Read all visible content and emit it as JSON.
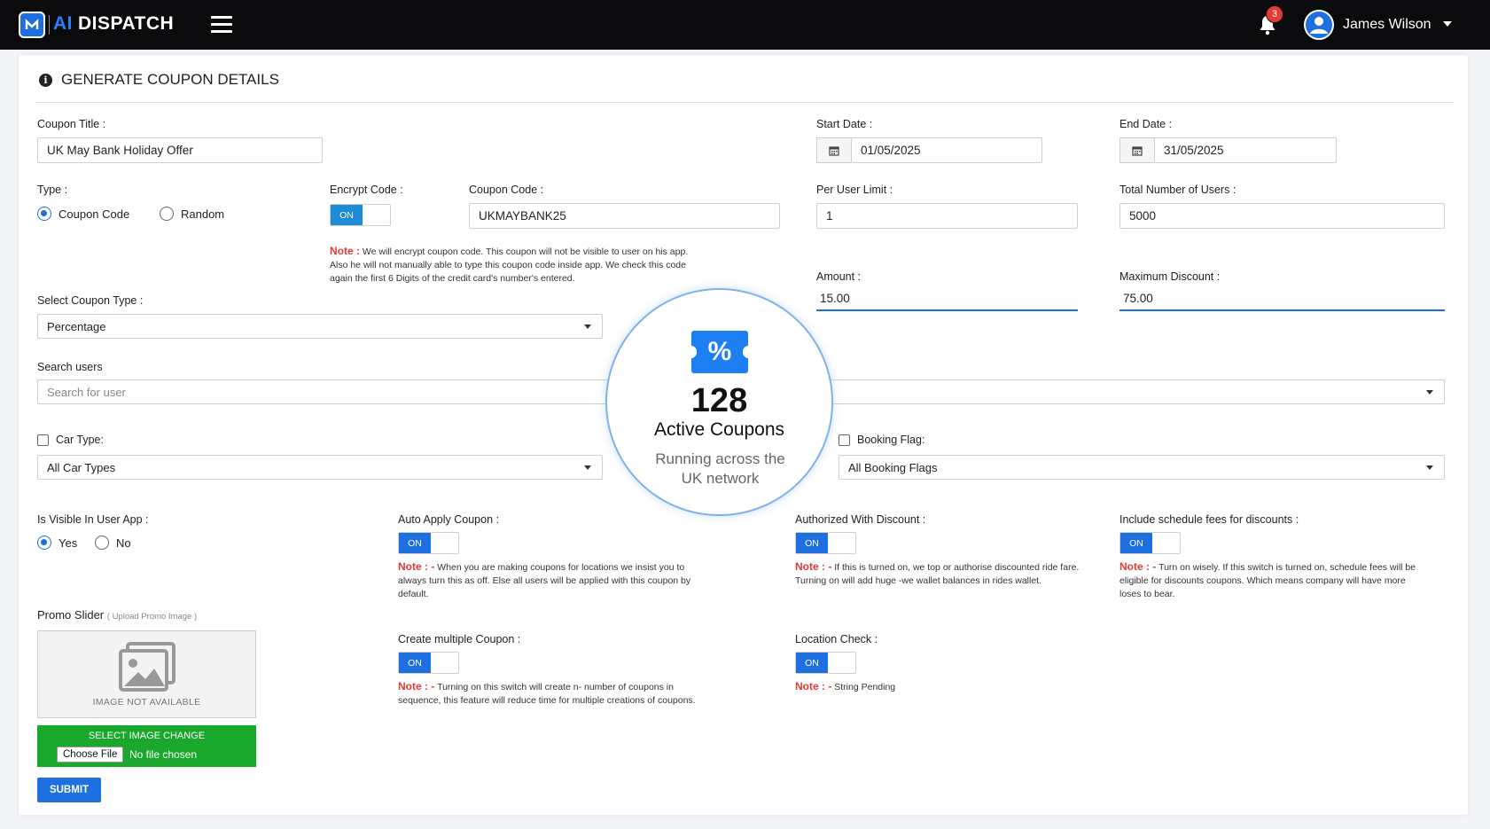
{
  "app": {
    "brand_ai": "AI",
    "brand_rest": "DISPATCH",
    "notification_count": "3",
    "user_name": "James Wilson"
  },
  "page": {
    "title": "GENERATE COUPON DETAILS"
  },
  "form": {
    "coupon_title": {
      "label": "Coupon Title :",
      "value": "UK May Bank Holiday Offer"
    },
    "start_date": {
      "label": "Start Date :",
      "value": "01/05/2025"
    },
    "end_date": {
      "label": "End Date :",
      "value": "31/05/2025"
    },
    "type": {
      "label": "Type :",
      "options": [
        "Coupon Code",
        "Random"
      ],
      "selected": "Coupon Code"
    },
    "encrypt_code": {
      "label": "Encrypt Code :",
      "state": "ON"
    },
    "coupon_code": {
      "label": "Coupon Code :",
      "value": "UKMAYBANK25"
    },
    "encrypt_note": {
      "prefix": "Note :",
      "text_lines": [
        "We will encrypt coupon code. This coupon will not be visible to user on his app.",
        "Also he will not manually able to type this coupon code inside app. We check this code",
        "again the first 6 Digits of the credit card's number's entered."
      ]
    },
    "per_user_limit": {
      "label": "Per User Limit :",
      "value": "1"
    },
    "total_users": {
      "label": "Total Number of Users :",
      "value": "5000"
    },
    "amount": {
      "label": "Amount :",
      "value": "15.00"
    },
    "max_discount": {
      "label": "Maximum Discount :",
      "value": "75.00"
    },
    "coupon_type": {
      "label": "Select Coupon Type :",
      "value": "Percentage"
    },
    "search_users": {
      "label": "Search users",
      "placeholder": "Search for user"
    },
    "car_type": {
      "label": "Car Type:",
      "value": "All Car Types"
    },
    "booking_flag": {
      "label": "Booking Flag:",
      "value": "All Booking Flags"
    },
    "visible_in_app": {
      "label": "Is Visible In User App :",
      "options": [
        "Yes",
        "No"
      ],
      "selected": "Yes"
    },
    "auto_apply": {
      "label": "Auto Apply Coupon :",
      "state": "ON",
      "note_prefix": "Note : -",
      "note_lines": [
        "When you are making coupons for locations we insist you to",
        "always turn this as off. Else all users will be applied with this coupon by",
        "default."
      ]
    },
    "authorized_discount": {
      "label": "Authorized With Discount :",
      "state": "ON",
      "note_prefix": "Note : -",
      "note_lines": [
        "If this is turned on, we top or authorise discounted ride fare.",
        "Turning on will add huge -we wallet balances in rides wallet."
      ]
    },
    "schedule_fees": {
      "label": "Include schedule fees for discounts :",
      "state": "ON",
      "note_prefix": "Note : -",
      "note_lines": [
        "Turn on wisely. If this switch is turned on, schedule fees will be",
        "eligible for discounts coupons. Which means company will have more",
        "loses to bear."
      ]
    },
    "multiple_coupon": {
      "label": "Create multiple Coupon :",
      "state": "ON",
      "note_prefix": "Note : -",
      "note_lines": [
        "Turning on this switch will create n- number of coupons in",
        "sequence, this feature will reduce time for multiple creations of coupons."
      ]
    },
    "location_check": {
      "label": "Location Check :",
      "state": "ON",
      "note_prefix": "Note : -",
      "note_text": "String Pending"
    },
    "promo": {
      "label": "Promo Slider",
      "sublabel": "( Upload Promo Image )",
      "image_na": "IMAGE NOT AVAILABLE",
      "select_label": "SELECT IMAGE CHANGE",
      "choose_file": "Choose File",
      "no_file": "No file chosen"
    },
    "submit": "SUBMIT"
  },
  "stat": {
    "icon_glyph": "%",
    "count": "128",
    "title": "Active Coupons",
    "subtitle_lines": [
      "Running across the",
      "UK network"
    ]
  },
  "colors": {
    "accent": "#1e6fe0",
    "note_red": "#e53935",
    "upload_green": "#19a82b",
    "topbar": "#0b0b0d"
  },
  "icons": [
    "logo-icon",
    "menu-icon",
    "bell-icon",
    "user-avatar-icon",
    "info-icon",
    "calendar-icon",
    "image-placeholder-icon",
    "coupon-ticket-icon"
  ]
}
